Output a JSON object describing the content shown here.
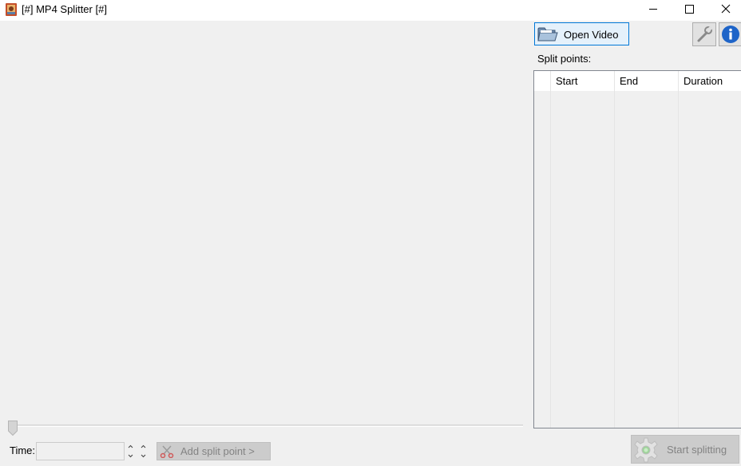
{
  "window": {
    "title": "[#] MP4 Splitter [#]",
    "controls": [
      "minimize",
      "maximize",
      "close"
    ]
  },
  "toolbar": {
    "open_video_label": "Open Video",
    "settings_icon": "wrench-icon",
    "info_icon": "info-icon"
  },
  "split_points": {
    "label": "Split points:",
    "columns": [
      "Start",
      "End",
      "Duration"
    ],
    "rows": []
  },
  "controls": {
    "time_label": "Time:",
    "time_value": "",
    "add_split_label": "Add split point >",
    "start_splitting_label": "Start splitting",
    "seek_position": 0
  },
  "colors": {
    "accent": "#0078d7",
    "disabled_text": "#838383",
    "info_blue": "#1e64c8"
  }
}
